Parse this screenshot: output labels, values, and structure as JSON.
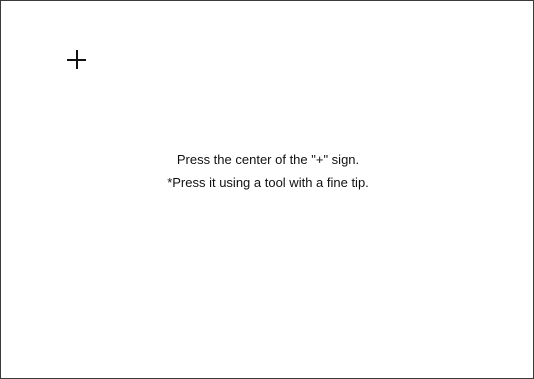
{
  "target": {
    "icon": "plus-crosshair-icon",
    "glyph": "+"
  },
  "instructions": {
    "line1": "Press the center of the \"+\" sign.",
    "line2": "*Press it using a tool with a fine tip."
  },
  "colors": {
    "background": "#ffffff",
    "text": "#111111",
    "border": "#3a3a3a"
  }
}
